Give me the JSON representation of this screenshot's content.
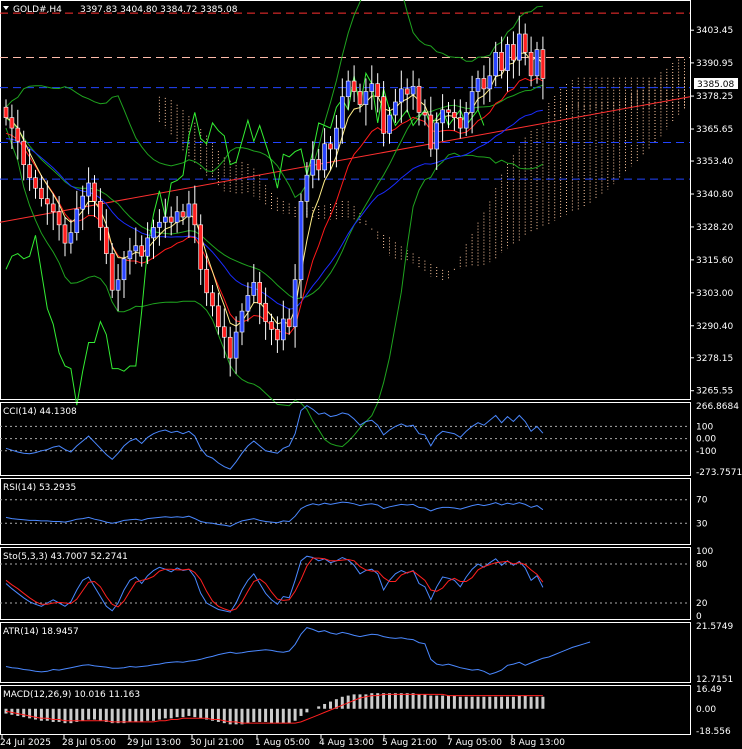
{
  "header": {
    "symbol": "GOLD#,H4",
    "ohlc": "3397.83 3404.80 3384.72 3385.08"
  },
  "price_tag": "3385.08",
  "colors": {
    "background": "#000000",
    "bull": "#2a45ff",
    "bear": "#ff2020",
    "bollinger": "#1fa31f",
    "ichimoku": "#ffc8a0",
    "ma_fast": "#ffee88",
    "ma_red": "#ff1a1a",
    "ma_blue": "#1a2cff",
    "osc": "#4a88ff",
    "signal": "#ff2020",
    "trend": "#ff3030",
    "hist": "#cccccc"
  },
  "chart_data": [
    {
      "type": "candlestick",
      "title": "GOLD#,H4",
      "ylim": [
        3262,
        3415
      ],
      "y_ticks": [
        "3403.45",
        "3390.95",
        "3378.25",
        "3365.65",
        "3353.40",
        "3340.80",
        "3328.20",
        "3315.60",
        "3303.00",
        "3290.40",
        "3278.15",
        "3265.55"
      ],
      "x_labels": [
        "24 Jul 2025",
        "28 Jul 05:00",
        "29 Jul 13:00",
        "30 Jul 21:00",
        "1 Aug 05:00",
        "4 Aug 13:00",
        "5 Aug 21:00",
        "7 Aug 05:00",
        "8 Aug 13:00"
      ],
      "close": [
        3370,
        3366,
        3361,
        3352,
        3347,
        3343,
        3339,
        3337,
        3334,
        3329,
        3322,
        3326,
        3335,
        3340,
        3345,
        3338,
        3328,
        3318,
        3304,
        3308,
        3316,
        3319,
        3321,
        3317,
        3324,
        3328,
        3330,
        3332,
        3330,
        3334,
        3332,
        3337,
        3329,
        3312,
        3303,
        3298,
        3290,
        3286,
        3278,
        3288,
        3296,
        3302,
        3307,
        3299,
        3292,
        3289,
        3285,
        3293,
        3290,
        3308,
        3338,
        3348,
        3354,
        3350,
        3360,
        3358,
        3366,
        3378,
        3384,
        3380,
        3375,
        3380,
        3383,
        3378,
        3364,
        3371,
        3376,
        3381,
        3379,
        3382,
        3372,
        3371,
        3358,
        3368,
        3373,
        3372,
        3370,
        3366,
        3372,
        3380,
        3385,
        3381,
        3386,
        3395,
        3388,
        3398,
        3392,
        3402,
        3395,
        3386,
        3396,
        3385
      ],
      "current": 3385.08,
      "h_lines": [
        3410,
        3393,
        3381.5,
        3360.5,
        3346.5
      ],
      "trendline": [
        3330,
        3378
      ],
      "bands_visible": true,
      "ichimoku_cloud_visible": true
    },
    {
      "type": "line",
      "title": "CCI(14) 44.1308",
      "ylim": [
        -273.7571,
        266.8684
      ],
      "y_ticks": [
        "266.8684",
        "100",
        "0.00",
        "-100",
        "-273.7571"
      ],
      "levels": [
        100,
        0,
        -100
      ],
      "series": [
        {
          "name": "CCI(14)",
          "values": [
            -80,
            -95,
            -110,
            -120,
            -125,
            -115,
            -100,
            -90,
            -70,
            -60,
            -90,
            -110,
            -60,
            -20,
            20,
            -30,
            -80,
            -130,
            -170,
            -120,
            -60,
            -20,
            0,
            -40,
            10,
            40,
            60,
            70,
            50,
            60,
            40,
            60,
            20,
            -80,
            -140,
            -160,
            -200,
            -230,
            -250,
            -190,
            -120,
            -60,
            -20,
            -60,
            -100,
            -110,
            -120,
            -80,
            -60,
            40,
            230,
            270,
            240,
            200,
            210,
            180,
            190,
            210,
            200,
            160,
            110,
            140,
            150,
            110,
            30,
            70,
            100,
            120,
            100,
            110,
            40,
            30,
            -60,
            20,
            60,
            50,
            40,
            10,
            60,
            100,
            130,
            110,
            150,
            190,
            130,
            180,
            140,
            190,
            140,
            60,
            100,
            44
          ]
        }
      ]
    },
    {
      "type": "line",
      "title": "RSI(14) 53.2935",
      "ylim": [
        0,
        100
      ],
      "y_ticks": [
        "70",
        "30"
      ],
      "levels": [
        70,
        30
      ],
      "series": [
        {
          "name": "RSI(14)",
          "values": [
            40,
            38,
            37,
            36,
            35,
            35,
            34,
            34,
            33,
            33,
            32,
            34,
            37,
            38,
            40,
            37,
            35,
            32,
            30,
            32,
            35,
            36,
            37,
            35,
            38,
            39,
            40,
            41,
            40,
            41,
            40,
            42,
            38,
            33,
            31,
            30,
            28,
            27,
            25,
            30,
            34,
            36,
            38,
            35,
            33,
            32,
            31,
            34,
            33,
            42,
            55,
            60,
            63,
            61,
            64,
            62,
            64,
            66,
            65,
            63,
            60,
            62,
            63,
            61,
            55,
            58,
            60,
            62,
            61,
            62,
            57,
            56,
            51,
            55,
            57,
            57,
            56,
            54,
            57,
            60,
            62,
            60,
            62,
            65,
            61,
            64,
            62,
            65,
            62,
            57,
            60,
            53
          ]
        }
      ]
    },
    {
      "type": "line",
      "title": "Sto(5,3,3) 43.7007 52.2741",
      "ylim": [
        0,
        100
      ],
      "y_ticks": [
        "100",
        "80",
        "20",
        "0"
      ],
      "levels": [
        80,
        20
      ],
      "series": [
        {
          "name": "Sto(5,3,3)",
          "values": [
            50,
            42,
            35,
            28,
            22,
            18,
            15,
            20,
            25,
            20,
            15,
            22,
            40,
            55,
            60,
            45,
            30,
            15,
            8,
            20,
            40,
            55,
            60,
            50,
            62,
            70,
            75,
            72,
            68,
            74,
            70,
            72,
            60,
            35,
            20,
            15,
            10,
            8,
            6,
            20,
            40,
            55,
            65,
            50,
            35,
            25,
            18,
            30,
            28,
            55,
            85,
            92,
            90,
            85,
            88,
            82,
            85,
            90,
            86,
            78,
            65,
            70,
            72,
            65,
            40,
            55,
            65,
            70,
            66,
            70,
            50,
            45,
            25,
            45,
            60,
            58,
            55,
            45,
            60,
            72,
            80,
            75,
            82,
            88,
            78,
            85,
            78,
            84,
            74,
            55,
            62,
            44
          ]
        },
        {
          "name": "signal",
          "values": [
            55,
            48,
            42,
            35,
            28,
            22,
            18,
            18,
            20,
            21,
            20,
            19,
            26,
            39,
            52,
            53,
            45,
            30,
            18,
            14,
            23,
            38,
            52,
            55,
            57,
            61,
            69,
            72,
            72,
            71,
            71,
            72,
            67,
            56,
            38,
            23,
            15,
            11,
            8,
            11,
            22,
            38,
            53,
            57,
            50,
            37,
            26,
            24,
            25,
            38,
            56,
            77,
            89,
            89,
            88,
            85,
            85,
            86,
            87,
            85,
            76,
            71,
            69,
            69,
            59,
            53,
            53,
            63,
            67,
            69,
            62,
            55,
            40,
            38,
            43,
            54,
            58,
            53,
            53,
            59,
            71,
            76,
            79,
            82,
            83,
            84,
            80,
            82,
            79,
            71,
            64,
            52
          ]
        }
      ]
    },
    {
      "type": "line",
      "title": "ATR(14) 18.9457",
      "ylim": [
        12.7151,
        21.5749
      ],
      "y_ticks": [
        "21.5749",
        "12.7151"
      ],
      "series": [
        {
          "name": "ATR(14)",
          "values": [
            14.8,
            14.6,
            14.5,
            14.3,
            14.2,
            14.0,
            13.9,
            14.0,
            14.3,
            14.2,
            14.4,
            14.6,
            14.8,
            15.0,
            15.1,
            14.9,
            14.8,
            14.7,
            14.5,
            14.5,
            14.6,
            14.8,
            14.7,
            14.8,
            14.9,
            15.1,
            15.2,
            15.4,
            15.5,
            15.6,
            15.5,
            15.7,
            15.8,
            16.0,
            16.3,
            16.5,
            16.8,
            17.0,
            17.2,
            17.0,
            17.1,
            17.3,
            17.4,
            17.5,
            17.6,
            17.5,
            17.3,
            17.2,
            17.4,
            18.5,
            20.2,
            21.3,
            21.0,
            20.6,
            20.8,
            20.4,
            20.2,
            20.5,
            20.3,
            20.0,
            19.8,
            20.0,
            20.2,
            20.1,
            19.8,
            19.6,
            19.5,
            19.6,
            19.4,
            19.3,
            18.8,
            18.6,
            16.0,
            15.2,
            15.0,
            15.2,
            14.9,
            14.6,
            14.4,
            14.2,
            14.3,
            14.0,
            13.5,
            13.8,
            14.2,
            15.0,
            15.2,
            15.5,
            15.0,
            15.4,
            15.8,
            16.2,
            16.4,
            16.8,
            17.2,
            17.6,
            18.0,
            18.3,
            18.6,
            18.9
          ]
        }
      ]
    },
    {
      "type": "bar",
      "title": "MACD(12,26,9) 10.016 11.163",
      "ylim": [
        -18.556,
        16.49
      ],
      "y_ticks": [
        "16.49",
        "0.00",
        "-18.556"
      ],
      "series": [
        {
          "name": "MACD(12,26,9)",
          "values": [
            -4,
            -5,
            -6,
            -7,
            -8,
            -9,
            -10,
            -10,
            -11,
            -11,
            -12,
            -12,
            -11,
            -10,
            -9,
            -9,
            -10,
            -11,
            -12,
            -12,
            -12,
            -11,
            -11,
            -11,
            -10,
            -10,
            -9,
            -8,
            -8,
            -7,
            -7,
            -6,
            -7,
            -8,
            -9,
            -10,
            -11,
            -12,
            -13,
            -13,
            -13,
            -12,
            -11,
            -11,
            -11,
            -12,
            -12,
            -12,
            -12,
            -10,
            -6,
            -3,
            0,
            2,
            4,
            6,
            8,
            10,
            11,
            12,
            12,
            12,
            13,
            13,
            13,
            13,
            13,
            13,
            13,
            13,
            12,
            12,
            11,
            11,
            11,
            11,
            11,
            10,
            10,
            10,
            10,
            10,
            10,
            10,
            10,
            10,
            10,
            11,
            11,
            10,
            10,
            10
          ]
        },
        {
          "name": "signal",
          "values": [
            -2,
            -3,
            -4,
            -5,
            -6,
            -7,
            -8,
            -8,
            -9,
            -9,
            -10,
            -10,
            -10,
            -10,
            -10,
            -10,
            -10,
            -10,
            -11,
            -11,
            -11,
            -11,
            -11,
            -11,
            -11,
            -11,
            -10,
            -10,
            -9,
            -9,
            -8,
            -8,
            -8,
            -8,
            -8,
            -9,
            -9,
            -10,
            -11,
            -11,
            -12,
            -12,
            -12,
            -12,
            -12,
            -12,
            -12,
            -12,
            -12,
            -12,
            -11,
            -9,
            -7,
            -5,
            -3,
            -1,
            1,
            3,
            5,
            7,
            9,
            10,
            11,
            11,
            12,
            12,
            12,
            12,
            12,
            12,
            12,
            12,
            12,
            12,
            12,
            11,
            11,
            11,
            11,
            11,
            11,
            11,
            11,
            11,
            11,
            11,
            11,
            11,
            11,
            11,
            11,
            11
          ]
        }
      ]
    }
  ]
}
